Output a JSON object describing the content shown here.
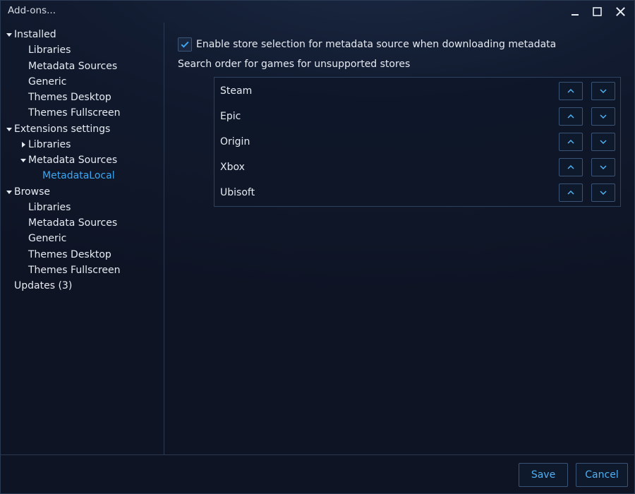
{
  "window": {
    "title": "Add-ons...",
    "accent": "#3ea6f0"
  },
  "sidebar": {
    "items": [
      {
        "label": "Installed",
        "expander": "expanded"
      },
      {
        "label": "Libraries"
      },
      {
        "label": "Metadata Sources"
      },
      {
        "label": "Generic"
      },
      {
        "label": "Themes Desktop"
      },
      {
        "label": "Themes Fullscreen"
      },
      {
        "label": "Extensions settings",
        "expander": "expanded"
      },
      {
        "label": "Libraries",
        "expander": "collapsed"
      },
      {
        "label": "Metadata Sources",
        "expander": "expanded"
      },
      {
        "label": "MetadataLocal",
        "selected": true
      },
      {
        "label": "Browse",
        "expander": "expanded"
      },
      {
        "label": "Libraries"
      },
      {
        "label": "Metadata Sources"
      },
      {
        "label": "Generic"
      },
      {
        "label": "Themes Desktop"
      },
      {
        "label": "Themes Fullscreen"
      },
      {
        "label": "Updates (3)"
      }
    ]
  },
  "content": {
    "enable_store_selection": {
      "checked": true,
      "label": "Enable store selection for metadata source when downloading metadata"
    },
    "search_order_label": "Search order for games for unsupported stores",
    "stores": [
      "Steam",
      "Epic",
      "Origin",
      "Xbox",
      "Ubisoft"
    ]
  },
  "footer": {
    "save_label": "Save",
    "cancel_label": "Cancel"
  }
}
